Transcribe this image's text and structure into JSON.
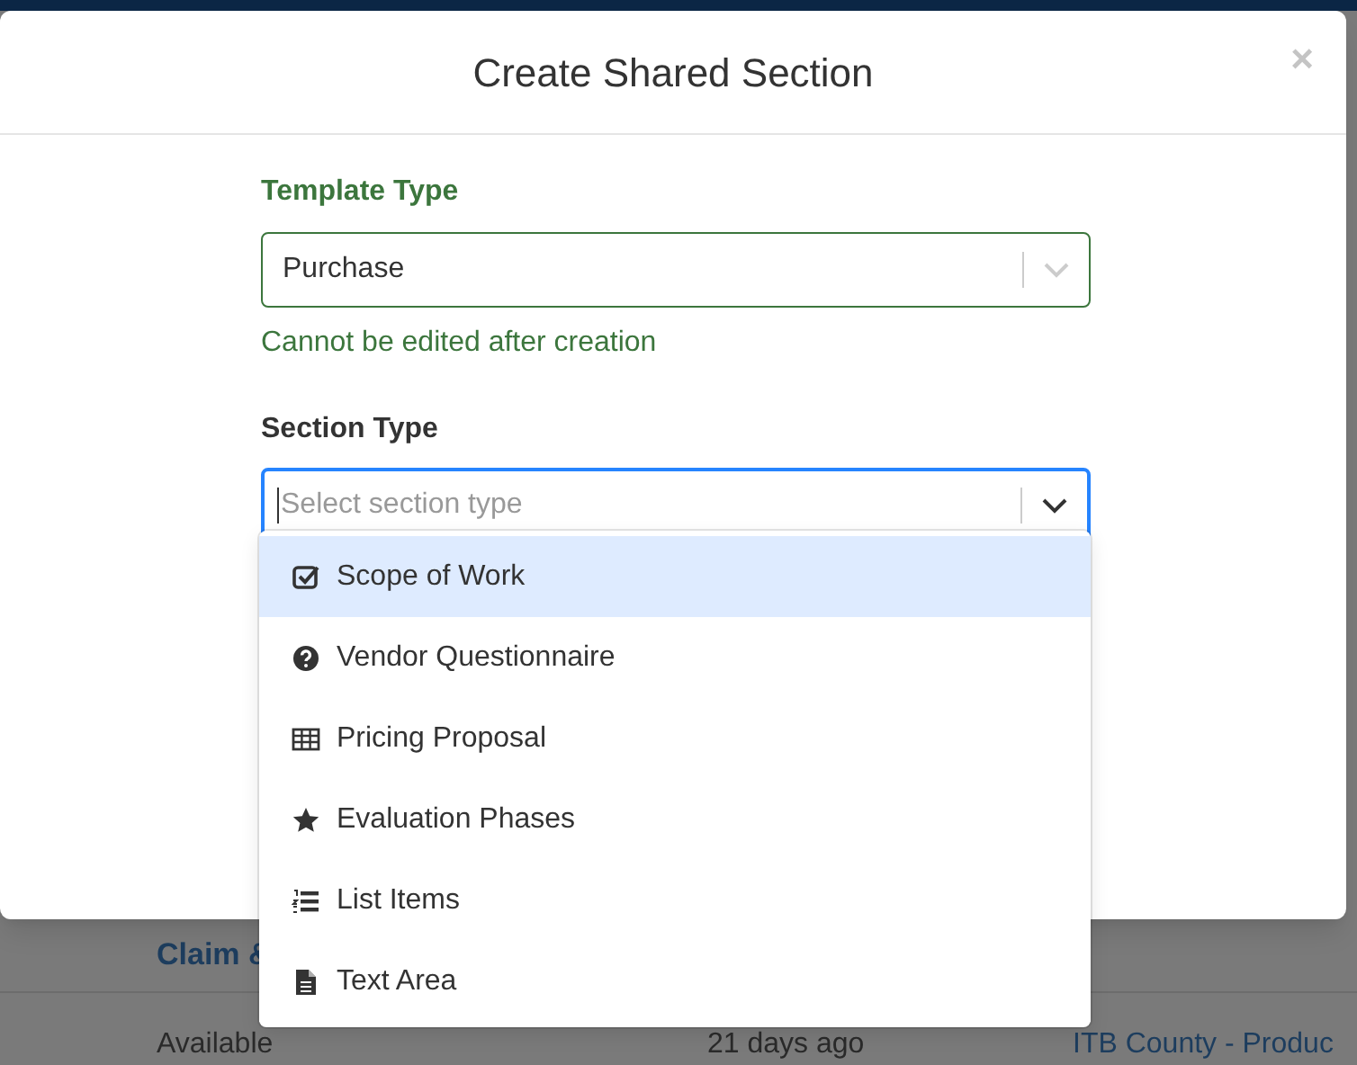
{
  "window": {
    "title": "Create Shared Section"
  },
  "close_button": {
    "label": "×"
  },
  "template_type": {
    "label": "Template Type",
    "value": "Purchase",
    "help": "Cannot be edited after creation"
  },
  "section_type": {
    "label": "Section Type",
    "placeholder": "Select section type",
    "expanded": true
  },
  "options": [
    {
      "label": "Scope of Work",
      "kind": "checkbox",
      "selected": true
    },
    {
      "label": "Vendor Questionnaire",
      "kind": "question",
      "selected": false
    },
    {
      "label": "Pricing Proposal",
      "kind": "table",
      "selected": false
    },
    {
      "label": "Evaluation Phases",
      "kind": "star",
      "selected": false
    },
    {
      "label": "List Items",
      "kind": "list",
      "selected": false
    },
    {
      "label": "Text Area",
      "kind": "file",
      "selected": false
    }
  ],
  "background_page": {
    "section_link": "Claim &",
    "rows": [
      {
        "column_1": "Available",
        "column_2": "21 days ago",
        "column_3": "ITB County - Produc"
      }
    ]
  }
}
